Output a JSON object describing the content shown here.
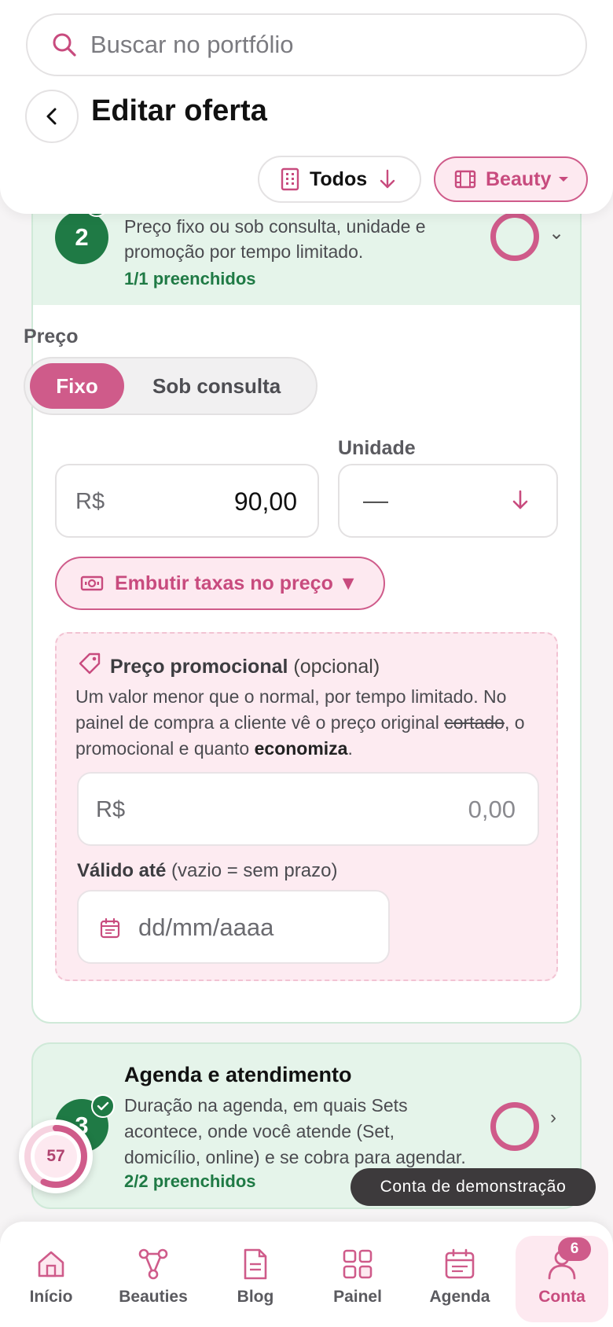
{
  "header": {
    "search_placeholder": "Buscar no portfólio",
    "title": "Editar oferta",
    "filter_todos": "Todos",
    "filter_beauty": "Beauty"
  },
  "section2": {
    "number": "2",
    "description_line1": "Preço fixo ou sob consulta, unidade e",
    "description_line2": "promoção por tempo limitado.",
    "filled": "1/1 preenchidos"
  },
  "price": {
    "label": "Preço",
    "option_fixed": "Fixo",
    "option_consult": "Sob consulta",
    "currency": "R$",
    "value": "90,00",
    "unit_label": "Unidade",
    "unit_value": "—",
    "embed_fees_label": "Embutir taxas no preço ▼"
  },
  "promo": {
    "title": "Preço promocional",
    "title_suffix": "(opcional)",
    "desc_part1": "Um valor menor que o normal, por tempo limitado. No painel de compra a cliente vê o preço original ",
    "desc_strike": "cortado",
    "desc_part2": ", o promocional e quanto ",
    "desc_bold": "economiza",
    "desc_end": ".",
    "currency": "R$",
    "value_placeholder": "0,00",
    "valid_label": "Válido até",
    "valid_hint": "(vazio = sem prazo)",
    "date_placeholder": "dd/mm/aaaa"
  },
  "section3": {
    "number": "3",
    "title": "Agenda e atendimento",
    "description_line1": "Duração na agenda, em quais Sets",
    "description_line2": "acontece, onde você atende (Set,",
    "description_line3": "domicílio, online) e se cobra para agendar.",
    "filled": "2/2 preenchidos"
  },
  "progress": {
    "value": "57",
    "fraction": 0.57
  },
  "toast": "Conta de demonstração",
  "nav": {
    "items": [
      {
        "label": "Início",
        "icon": "home-icon"
      },
      {
        "label": "Beauties",
        "icon": "network-icon"
      },
      {
        "label": "Blog",
        "icon": "document-icon"
      },
      {
        "label": "Painel",
        "icon": "grid-icon"
      },
      {
        "label": "Agenda",
        "icon": "calendar-icon"
      },
      {
        "label": "Conta",
        "icon": "user-icon"
      }
    ],
    "badge": "6",
    "active": "Conta"
  },
  "colors": {
    "accent": "#cf5b8a",
    "accent_light": "#fde9f0",
    "success": "#1f7a45",
    "success_bg": "#e5f4ea"
  }
}
